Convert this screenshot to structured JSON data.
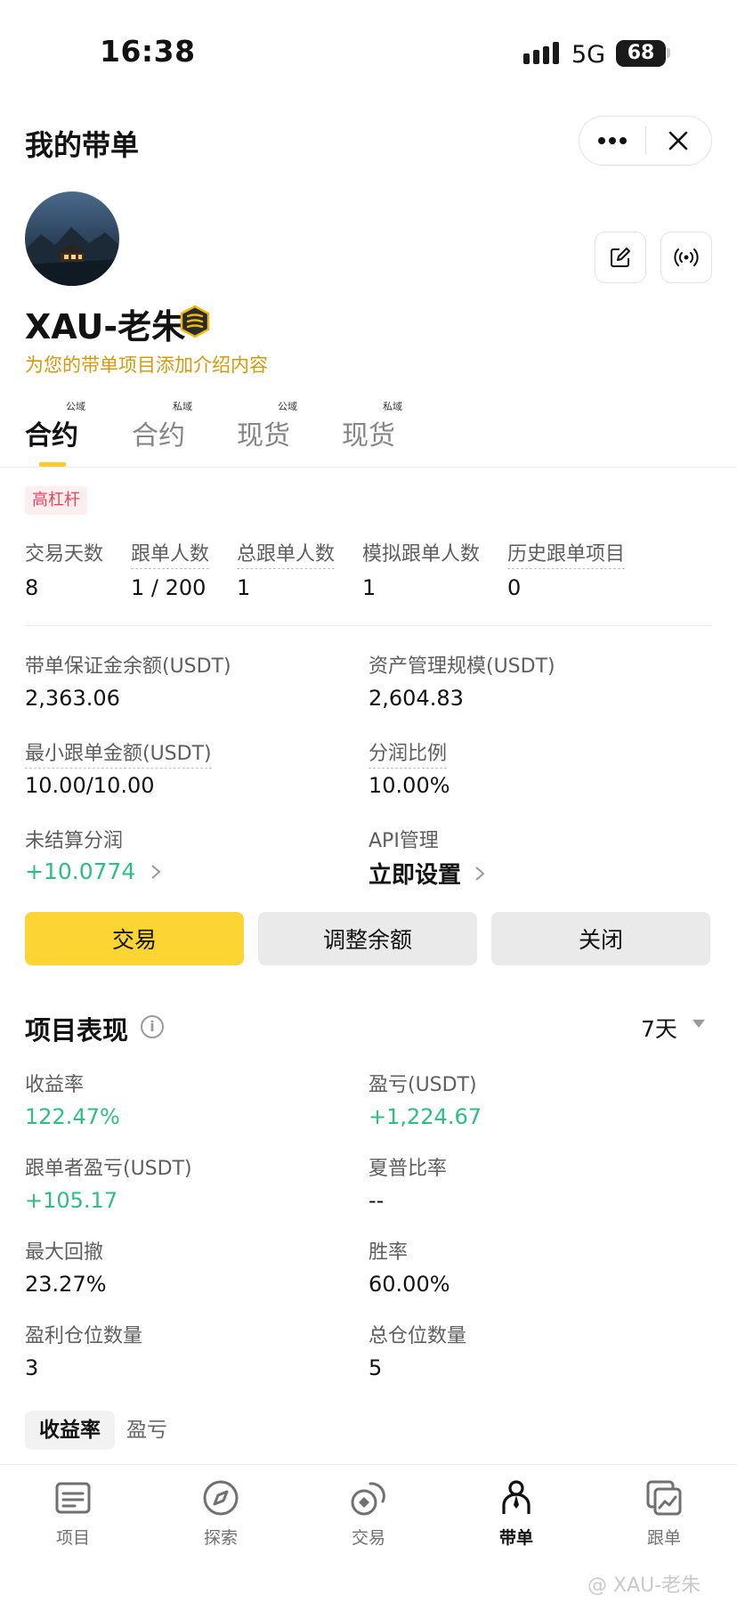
{
  "status_bar": {
    "time": "16:38",
    "network": "5G",
    "battery": "68"
  },
  "header": {
    "title": "我的带单"
  },
  "profile": {
    "username": "XAU-老朱",
    "intro_prompt": "为您的带单项目添加介绍内容"
  },
  "tabs": [
    {
      "label": "合约",
      "sup": "公域",
      "active": true
    },
    {
      "label": "合约",
      "sup": "私域",
      "active": false
    },
    {
      "label": "现货",
      "sup": "公域",
      "active": false
    },
    {
      "label": "现货",
      "sup": "私域",
      "active": false
    }
  ],
  "tag": "高杠杆",
  "stats": [
    {
      "label": "交易天数",
      "value": "8"
    },
    {
      "label": "跟单人数",
      "value": "1 / 200"
    },
    {
      "label": "总跟单人数",
      "value": "1"
    },
    {
      "label": "模拟跟单人数",
      "value": "1"
    },
    {
      "label": "历史跟单项目",
      "value": "0"
    }
  ],
  "account": {
    "margin_balance": {
      "label": "带单保证金余额(USDT)",
      "value": "2,363.06"
    },
    "aum": {
      "label": "资产管理规模(USDT)",
      "value": "2,604.83"
    },
    "min_copy": {
      "label": "最小跟单金额(USDT)",
      "value": "10.00/10.00"
    },
    "profit_share": {
      "label": "分润比例",
      "value": "10.00%"
    },
    "unsettled": {
      "label": "未结算分润",
      "value": "+10.0774"
    },
    "api": {
      "label": "API管理",
      "value": "立即设置"
    }
  },
  "buttons": {
    "trade": "交易",
    "adjust": "调整余额",
    "close": "关闭"
  },
  "performance": {
    "title": "项目表现",
    "period": "7天",
    "metrics": [
      {
        "label": "收益率",
        "value": "122.47%",
        "positive": true
      },
      {
        "label": "盈亏(USDT)",
        "value": "+1,224.67",
        "positive": true
      },
      {
        "label": "跟单者盈亏(USDT)",
        "value": "+105.17",
        "positive": true
      },
      {
        "label": "夏普比率",
        "value": "--",
        "positive": false
      },
      {
        "label": "最大回撤",
        "value": "23.27%",
        "positive": false
      },
      {
        "label": "胜率",
        "value": "60.00%",
        "positive": false
      },
      {
        "label": "盈利仓位数量",
        "value": "3",
        "positive": false
      },
      {
        "label": "总仓位数量",
        "value": "5",
        "positive": false
      }
    ],
    "segments": [
      "收益率",
      "盈亏"
    ]
  },
  "nav": [
    {
      "label": "项目",
      "icon": "list-icon",
      "active": false
    },
    {
      "label": "探索",
      "icon": "compass-icon",
      "active": false
    },
    {
      "label": "交易",
      "icon": "coins-icon",
      "active": false
    },
    {
      "label": "带单",
      "icon": "person-icon",
      "active": true
    },
    {
      "label": "跟单",
      "icon": "copy-chart-icon",
      "active": false
    }
  ],
  "watermark": "@ XAU-老朱",
  "colors": {
    "accent": "#fcd535",
    "profit": "#2ebd85",
    "warning_text": "#d29b0c",
    "tag_red": "#e8455a"
  }
}
